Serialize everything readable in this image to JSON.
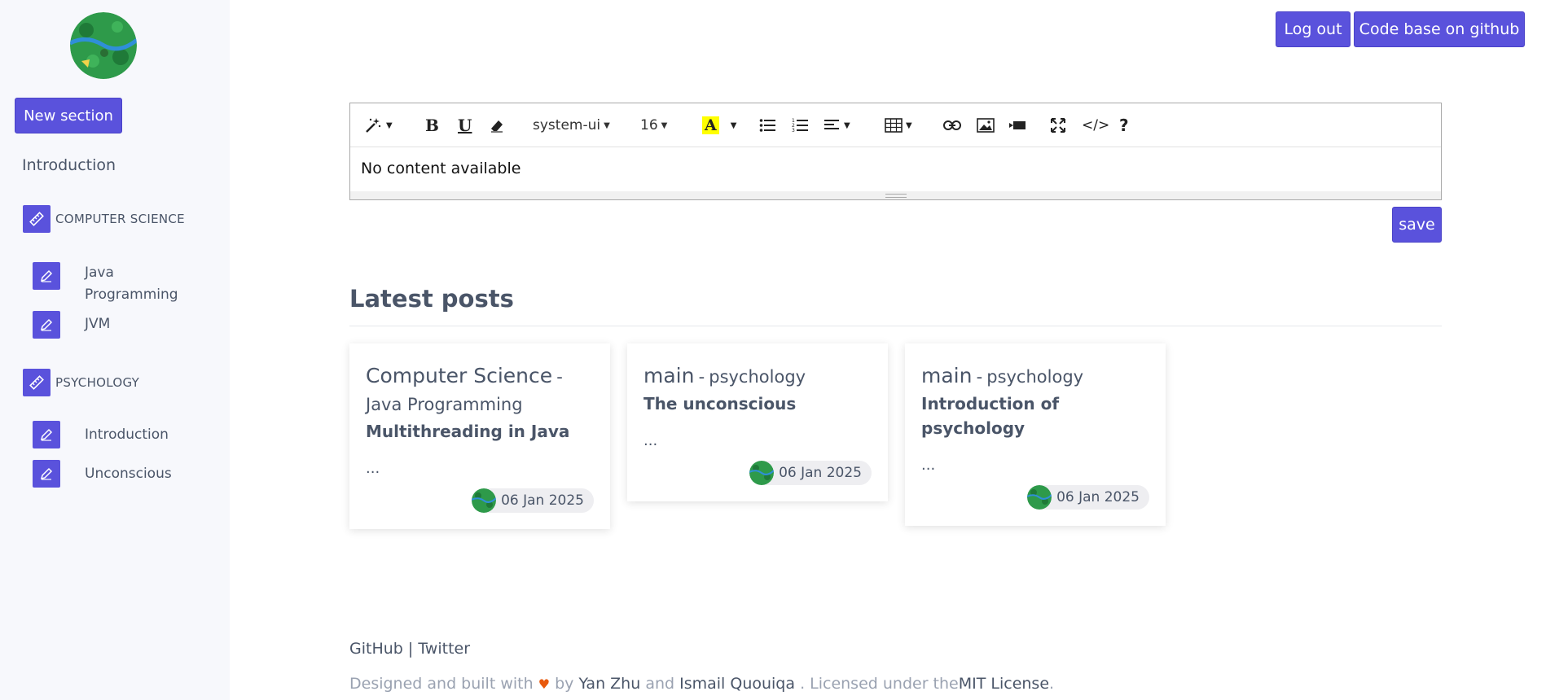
{
  "header": {
    "logout_label": "Log out",
    "github_label": "Code base on github"
  },
  "sidebar": {
    "new_section_label": "New section",
    "intro_label": "Introduction",
    "sections": [
      {
        "label": "COMPUTER SCIENCE",
        "items": [
          "Java Programming",
          "JVM"
        ]
      },
      {
        "label": "PSYCHOLOGY",
        "items": [
          "Introduction",
          "Unconscious"
        ]
      }
    ]
  },
  "editor": {
    "font_family": "system-ui",
    "font_size": "16",
    "content": "No content available",
    "save_label": "save",
    "tools": [
      "magic-icon",
      "bold-icon",
      "underline-icon",
      "eraser-icon",
      "font-color-icon",
      "unordered-list-icon",
      "ordered-list-icon",
      "align-icon",
      "table-icon",
      "link-icon",
      "picture-icon",
      "video-icon",
      "fullscreen-icon",
      "code-view-icon",
      "help-icon"
    ]
  },
  "latest": {
    "title": "Latest posts",
    "posts": [
      {
        "section": "Computer Science",
        "sep": "-",
        "subsection": "Java Programming",
        "title": "Multithreading in Java",
        "excerpt": "...",
        "date": "06 Jan 2025"
      },
      {
        "section": "main",
        "sep": "-",
        "subsection": "psychology",
        "title": "The unconscious",
        "excerpt": "...",
        "date": "06 Jan 2025"
      },
      {
        "section": "main",
        "sep": "-",
        "subsection": "psychology",
        "title": "Introduction of psychology",
        "excerpt": "...",
        "date": "06 Jan 2025"
      }
    ]
  },
  "footer": {
    "github": "GitHub",
    "sep": "|",
    "twitter": "Twitter",
    "designed": "Designed and built with",
    "by": "by",
    "author1": "Yan Zhu",
    "and": "and",
    "author2": "Ismail Quouiqa",
    "licensed": ". Licensed under the",
    "license": "MIT License",
    "period": "."
  },
  "colors": {
    "accent": "#5a52dc",
    "sidebar_bg": "#f7f8fc",
    "text": "#4a5568",
    "muted": "#9aa2b1",
    "heart": "#e8590c"
  }
}
